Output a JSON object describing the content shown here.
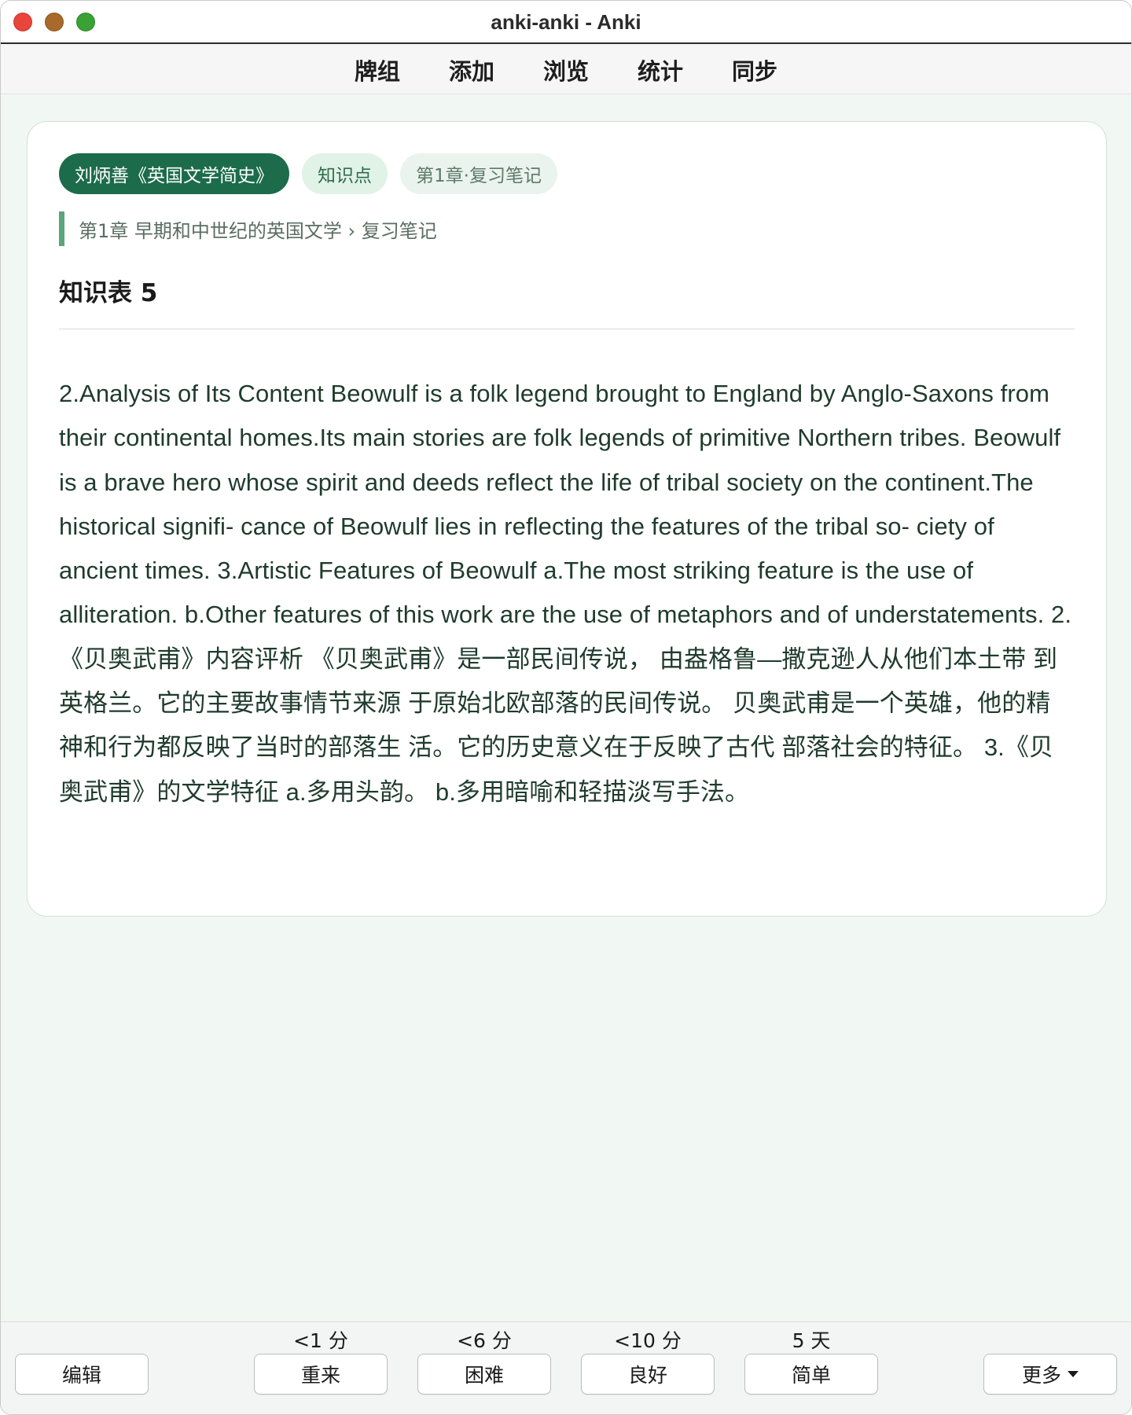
{
  "window": {
    "title": "anki-anki - Anki"
  },
  "toolbar": {
    "items": [
      {
        "label": "牌组"
      },
      {
        "label": "添加"
      },
      {
        "label": "浏览"
      },
      {
        "label": "统计"
      },
      {
        "label": "同步"
      }
    ]
  },
  "card": {
    "tags": [
      "刘炳善《英国文学简史》",
      "知识点",
      "第1章·复习笔记"
    ],
    "breadcrumb": "第1章 早期和中世纪的英国文学 › 复习笔记",
    "title": "知识表 5",
    "body": "2.Analysis of Its Content Beowulf is a folk legend brought to England by Anglo-Saxons from their continental homes.Its main stories are folk legends of primitive Northern tribes. Beowulf is a brave hero whose spirit and deeds reflect the life of tribal society on the continent.The historical signifi- cance of Beowulf lies in reflecting the features of the tribal so- ciety of ancient times. 3.Artistic Features of Beowulf a.The most striking feature is the use of alliteration. b.Other features of this work are the use of metaphors and of understatements. 2.《贝奥武甫》内容评析 《贝奥武甫》是一部民间传说， 由盎格鲁—撒克逊人从他们本土带 到英格兰。它的主要故事情节来源 于原始北欧部落的民间传说。 贝奥武甫是一个英雄，他的精 神和行为都反映了当时的部落生 活。它的历史意义在于反映了古代 部落社会的特征。 3.《贝奥武甫》的文学特征 a.多用头韵。 b.多用暗喻和轻描淡写手法。"
  },
  "bottom": {
    "edit_label": "编辑",
    "more_label": "更多",
    "answers": [
      {
        "interval": "<1 分",
        "label": "重来"
      },
      {
        "interval": "<6 分",
        "label": "困难"
      },
      {
        "interval": "<10 分",
        "label": "良好"
      },
      {
        "interval": "5 天",
        "label": "简单"
      }
    ]
  }
}
